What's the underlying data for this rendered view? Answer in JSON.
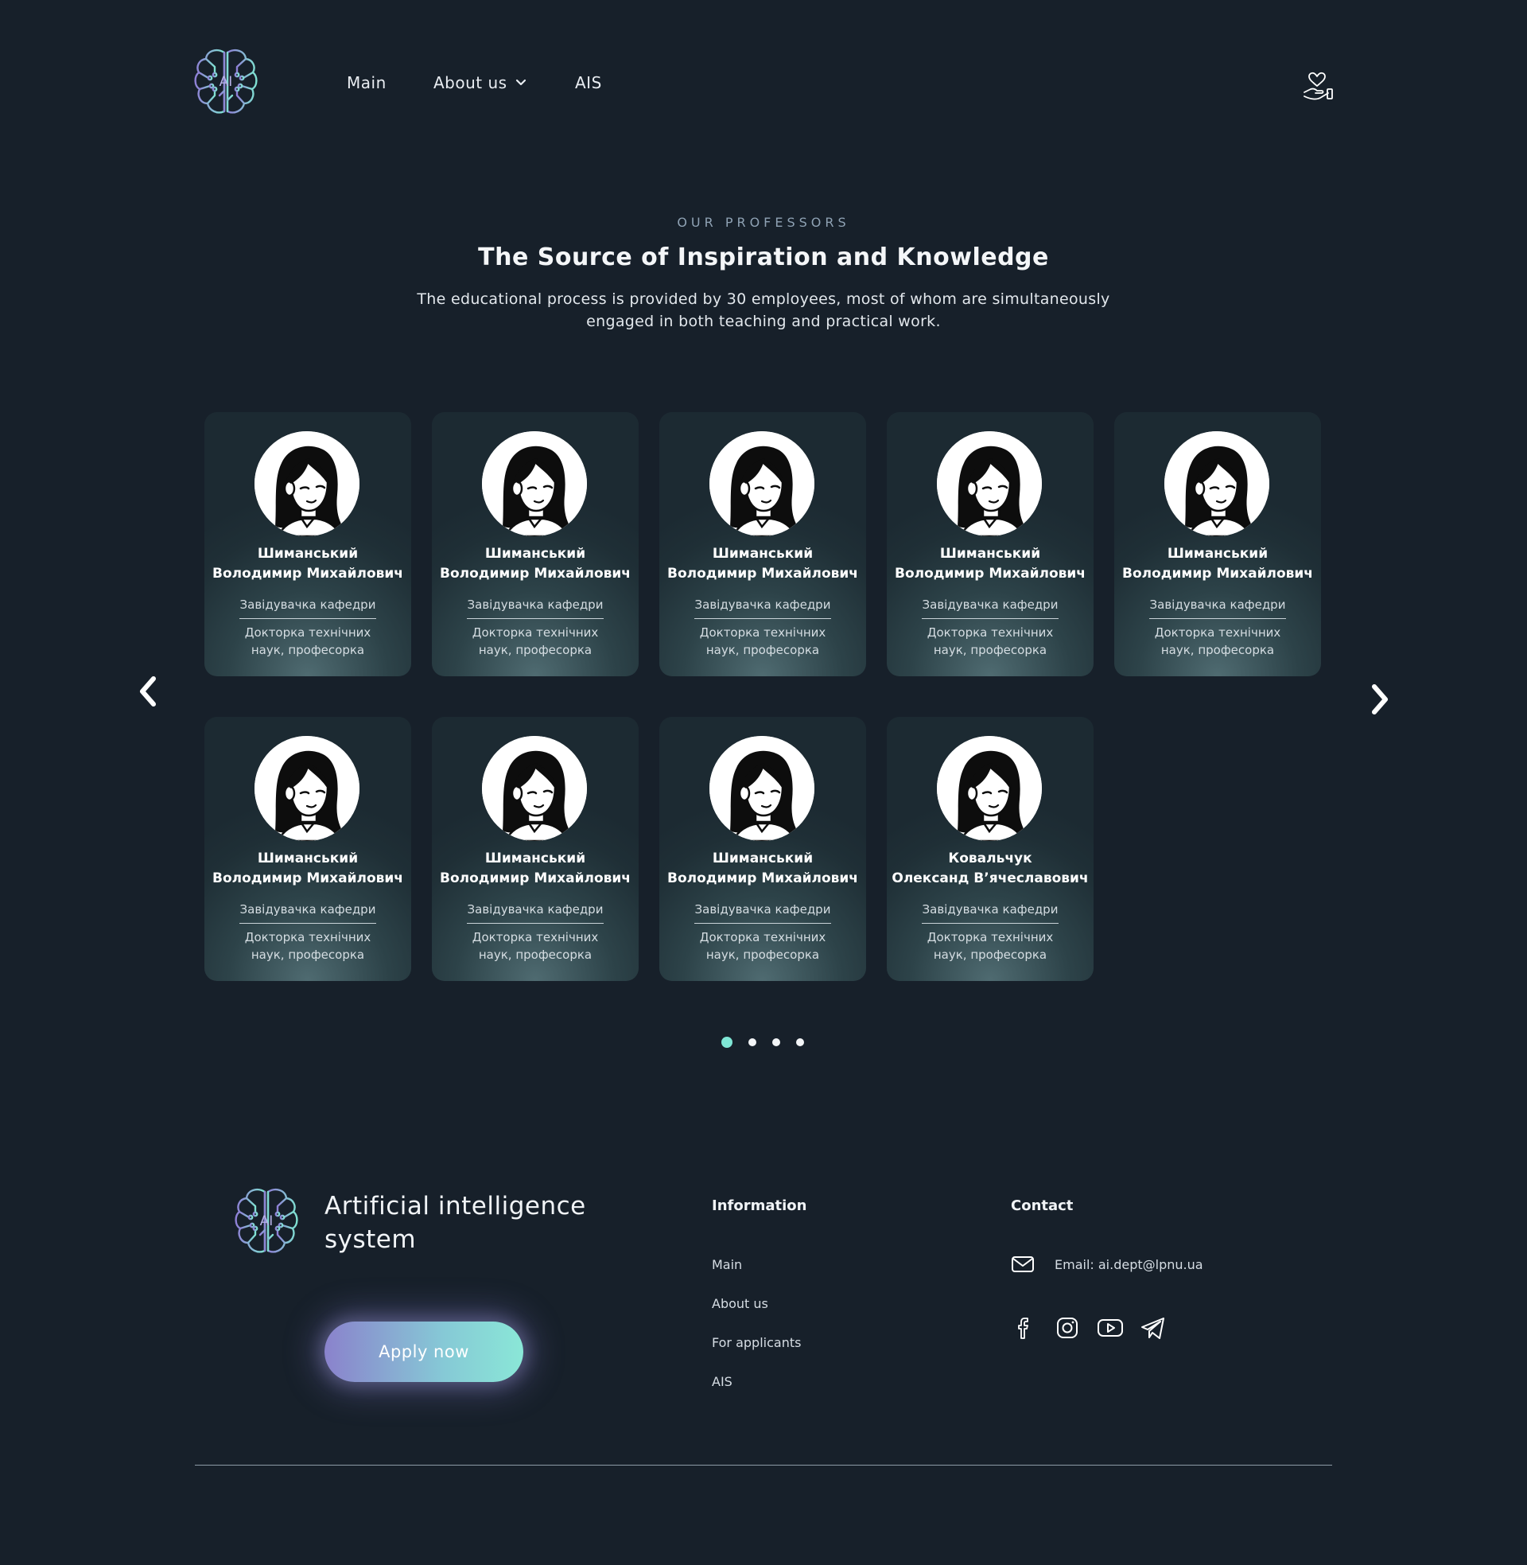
{
  "header": {
    "nav": [
      {
        "label": "Main"
      },
      {
        "label": "About us",
        "has_dropdown": true
      },
      {
        "label": "AIS"
      }
    ],
    "logo_text": "AI",
    "icons": [
      "ai-brain-logo-icon",
      "chevron-down-icon",
      "hand-heart-icon"
    ]
  },
  "section": {
    "eyebrow": "OUR PROFESSORS",
    "title": "The Source of Inspiration and Knowledge",
    "subtitle": "The educational process is provided by 30 employees, most of whom are simultaneously engaged in both teaching and practical work."
  },
  "professors": [
    {
      "surname": "Шиманський",
      "given": "Володимир Михайлович",
      "role": "Завідувачка кафедри",
      "degree_1": "Докторка технічних",
      "degree_2": "наук, професорка"
    },
    {
      "surname": "Шиманський",
      "given": "Володимир Михайлович",
      "role": "Завідувачка кафедри",
      "degree_1": "Докторка технічних",
      "degree_2": "наук, професорка"
    },
    {
      "surname": "Шиманський",
      "given": "Володимир Михайлович",
      "role": "Завідувачка кафедри",
      "degree_1": "Докторка технічних",
      "degree_2": "наук, професорка"
    },
    {
      "surname": "Шиманський",
      "given": "Володимир Михайлович",
      "role": "Завідувачка кафедри",
      "degree_1": "Докторка технічних",
      "degree_2": "наук, професорка"
    },
    {
      "surname": "Шиманський",
      "given": "Володимир Михайлович",
      "role": "Завідувачка кафедри",
      "degree_1": "Докторка технічних",
      "degree_2": "наук, професорка"
    },
    {
      "surname": "Шиманський",
      "given": "Володимир Михайлович",
      "role": "Завідувачка кафедри",
      "degree_1": "Докторка технічних",
      "degree_2": "наук, професорка"
    },
    {
      "surname": "Шиманський",
      "given": "Володимир Михайлович",
      "role": "Завідувачка кафедри",
      "degree_1": "Докторка технічних",
      "degree_2": "наук, професорка"
    },
    {
      "surname": "Шиманський",
      "given": "Володимир Михайлович",
      "role": "Завідувачка кафедри",
      "degree_1": "Докторка технічних",
      "degree_2": "наук, професорка"
    },
    {
      "surname": "Ковальчук",
      "given": "Олександ В’ячеславович",
      "role": "Завідувачка кафедри",
      "degree_1": "Докторка технічних",
      "degree_2": "наук, професорка"
    }
  ],
  "carousel": {
    "page_count": 4,
    "active_page": 1,
    "icons": [
      "chevron-left-icon",
      "chevron-right-icon"
    ]
  },
  "footer": {
    "brand_line_1": "Artificial intelligence",
    "brand_line_2": "system",
    "apply_label": "Apply now",
    "information": {
      "heading": "Information",
      "links": [
        "Main",
        "About us",
        "For applicants",
        "AIS"
      ]
    },
    "contact": {
      "heading": "Contact",
      "email_text": "Email: ai.dept@lpnu.ua"
    },
    "social_icons": [
      "facebook-icon",
      "instagram-icon",
      "youtube-icon",
      "telegram-icon"
    ]
  },
  "colors": {
    "background": "#17202a",
    "accent_teal": "#7fe6d5",
    "accent_purple": "#8a82cc"
  }
}
